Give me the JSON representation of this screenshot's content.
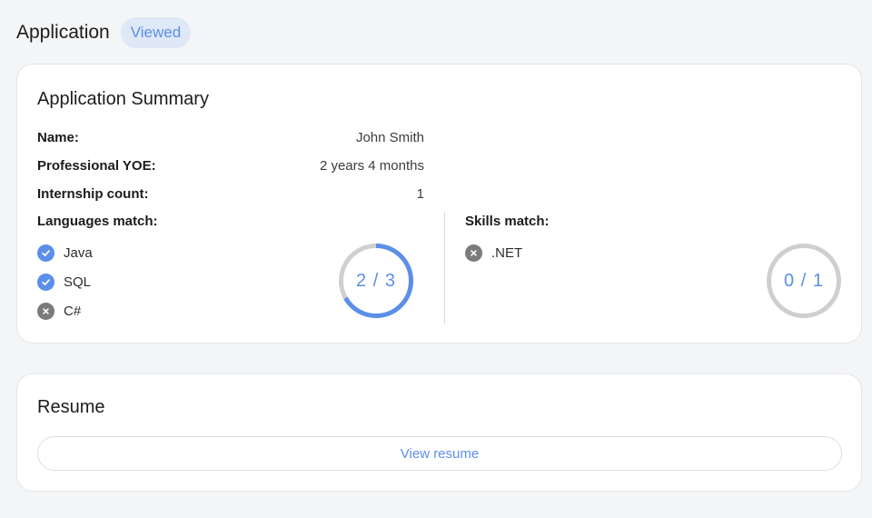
{
  "header": {
    "title": "Application",
    "status_badge": "Viewed"
  },
  "summary": {
    "title": "Application Summary",
    "fields": [
      {
        "label": "Name:",
        "value": "John Smith"
      },
      {
        "label": "Professional YOE:",
        "value": "2 years 4 months"
      },
      {
        "label": "Internship count:",
        "value": "1"
      }
    ],
    "languages": {
      "label": "Languages match:",
      "items": [
        {
          "name": "Java",
          "status": "matched",
          "icon": "check-icon"
        },
        {
          "name": "SQL",
          "status": "matched",
          "icon": "check-icon"
        },
        {
          "name": "C#",
          "status": "unmatched",
          "icon": "x-icon"
        }
      ],
      "score_text": "2 / 3",
      "matched": 2,
      "total": 3
    },
    "skills": {
      "label": "Skills match:",
      "items": [
        {
          "name": ".NET",
          "status": "unmatched",
          "icon": "x-icon"
        }
      ],
      "score_text": "0 / 1",
      "matched": 0,
      "total": 1
    }
  },
  "resume": {
    "title": "Resume",
    "button_label": "View resume"
  },
  "colors": {
    "accent": "#5b8fe8",
    "badge_bg": "#dfe8f7",
    "ring_track": "#cfcfcf",
    "unmatched_icon": "#7b7b7b"
  }
}
